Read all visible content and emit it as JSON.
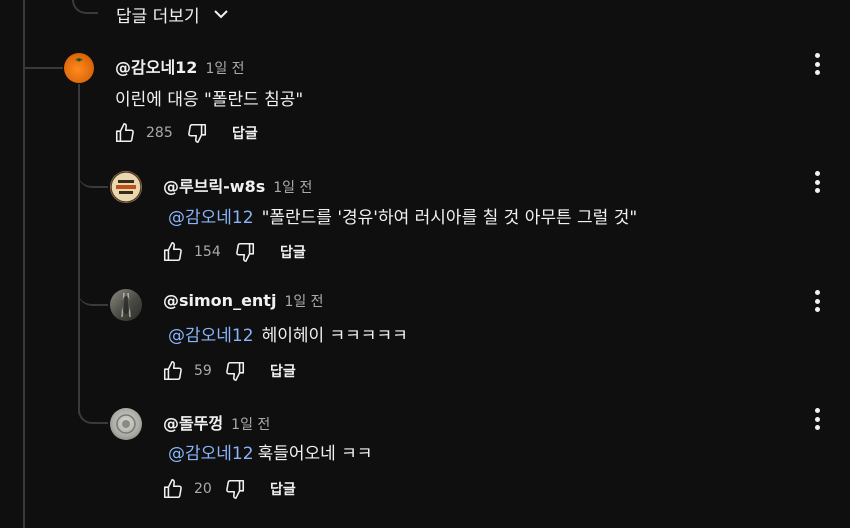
{
  "more_replies": {
    "label": "답글 더보기"
  },
  "comments": [
    {
      "author": "@감오네12",
      "time": "1일 전",
      "mention": "",
      "text": "이린에 대응 \"폴란드 침공\"",
      "likes": "285",
      "reply_label": "답글"
    },
    {
      "author": "@루브릭-w8s",
      "time": "1일 전",
      "mention": "@감오네12",
      "text": "\"폴란드를 '경유'하여 러시아를 칠 것 아무튼 그럴 것\"",
      "likes": "154",
      "reply_label": "답글"
    },
    {
      "author": "@simon_entj",
      "time": "1일 전",
      "mention": "@감오네12",
      "text": "헤이헤이 ㅋㅋㅋㅋㅋ",
      "likes": "59",
      "reply_label": "답글"
    },
    {
      "author": "@돌뚜껑",
      "time": "1일 전",
      "mention": "@감오네12",
      "text": "훅들어오네 ㅋㅋ",
      "likes": "20",
      "reply_label": "답글"
    }
  ],
  "icons": {
    "like": "thumbs-up-icon",
    "dislike": "thumbs-down-icon",
    "more": "more-vert-icon",
    "expand": "chevron-down-icon"
  },
  "colors": {
    "background": "#0f0f0f",
    "mention": "#8ab4f8",
    "secondary_text": "#aaaaaa"
  }
}
